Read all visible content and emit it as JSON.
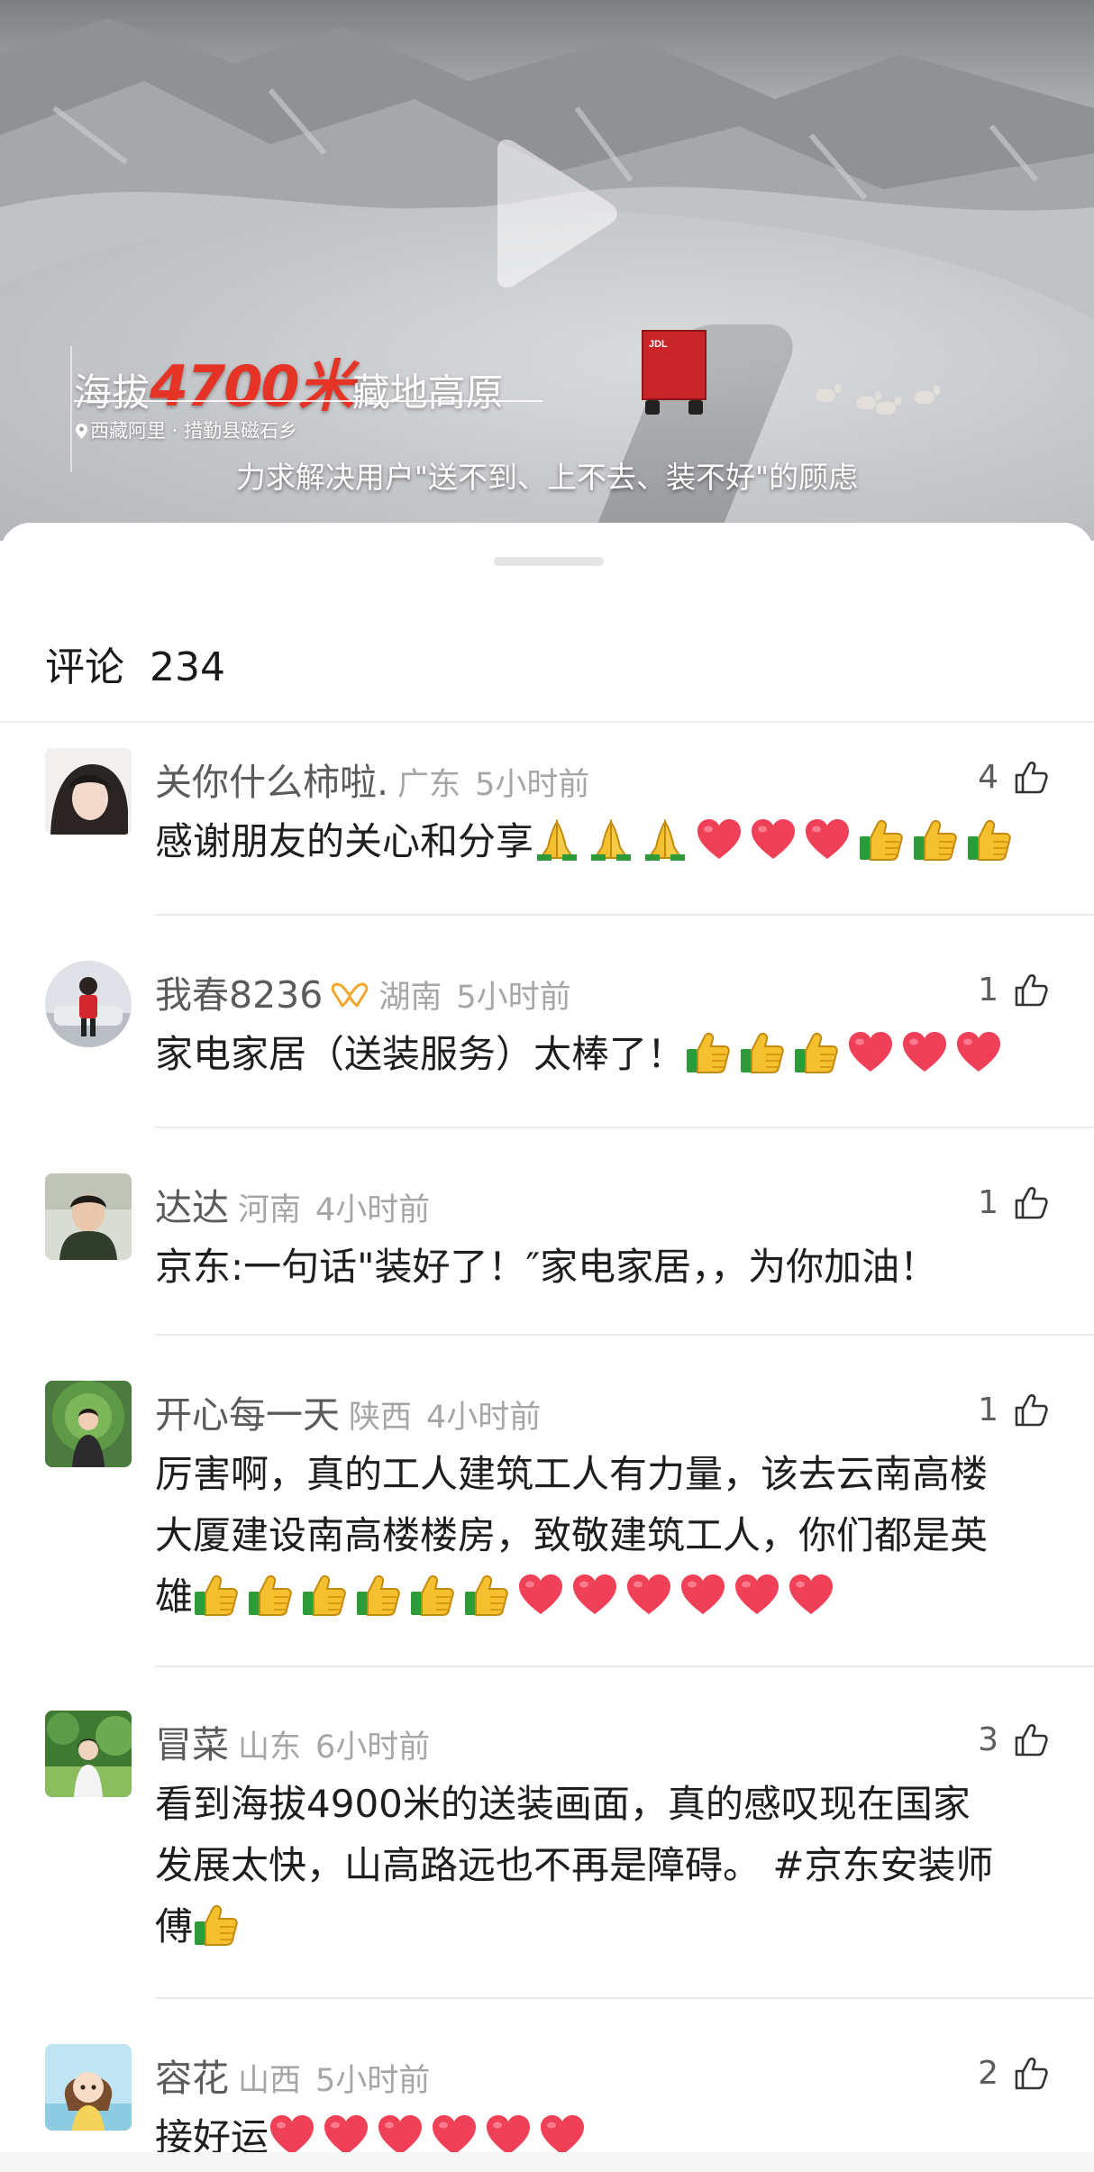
{
  "video": {
    "title_prefix": "海拔",
    "title_highlight": "4700米",
    "title_suffix": "藏地高原",
    "location": "西藏阿里 · 措勤县磁石乡",
    "subtitle": "力求解决用户\"送不到、上不去、装不好\"的顾虑",
    "truck_logo": "JDL",
    "highlight_color": "#e53326"
  },
  "comments_panel": {
    "title": "评论",
    "count": "234"
  },
  "comments": [
    {
      "name": "关你什么柿啦.",
      "region": "广东",
      "time": "5小时前",
      "likes": "4",
      "text": "感谢朋友的关心和分享",
      "emojis": [
        "pray-emoji",
        "pray-emoji",
        "pray-emoji",
        "heart-emoji",
        "heart-emoji",
        "heart-emoji",
        "thumbs-up-emoji",
        "thumbs-up-emoji",
        "thumbs-up-emoji"
      ]
    },
    {
      "name": "我春8236",
      "region": "湖南",
      "time": "5小时前",
      "likes": "1",
      "text": "家电家居（送装服务）太棒了！",
      "emojis": [
        "thumbs-up-emoji",
        "thumbs-up-emoji",
        "thumbs-up-emoji",
        "heart-emoji",
        "heart-emoji",
        "heart-emoji"
      ]
    },
    {
      "name": "达达",
      "region": "河南",
      "time": "4小时前",
      "likes": "1",
      "text": "京东:一句话\"装好了！″家电家居，，为你加油！",
      "emojis": []
    },
    {
      "name": "开心每一天",
      "region": "陕西",
      "time": "4小时前",
      "likes": "1",
      "text_line1": "厉害啊，真的工人建筑工人有力量，该去云南高楼",
      "text_line2": "大厦建设南高楼楼房，致敬建筑工人，你们都是英",
      "text_line3": "雄",
      "emojis": [
        "thumbs-up-emoji",
        "thumbs-up-emoji",
        "thumbs-up-emoji",
        "thumbs-up-emoji",
        "thumbs-up-emoji",
        "thumbs-up-emoji",
        "heart-emoji",
        "heart-emoji",
        "heart-emoji",
        "heart-emoji",
        "heart-emoji",
        "heart-emoji"
      ]
    },
    {
      "name": "冒菜",
      "region": "山东",
      "time": "6小时前",
      "likes": "3",
      "text_line1": "看到海拔4900米的送装画面，真的感叹现在国家",
      "text_line2": "发展太快，山高路远也不再是障碍。 #京东安装师",
      "text_line3": "傅",
      "emojis": [
        "thumbs-up-emoji"
      ]
    },
    {
      "name": "容花",
      "region": "山西",
      "time": "5小时前",
      "likes": "2",
      "text": "接好运",
      "emojis": [
        "heart-emoji",
        "heart-emoji",
        "heart-emoji",
        "heart-emoji",
        "heart-emoji",
        "heart-emoji"
      ]
    }
  ],
  "icons": {
    "like": "thumbs-up-outline-icon",
    "play": "play-icon",
    "location": "location-pin-icon",
    "badge": "ribbon-badge-icon"
  }
}
